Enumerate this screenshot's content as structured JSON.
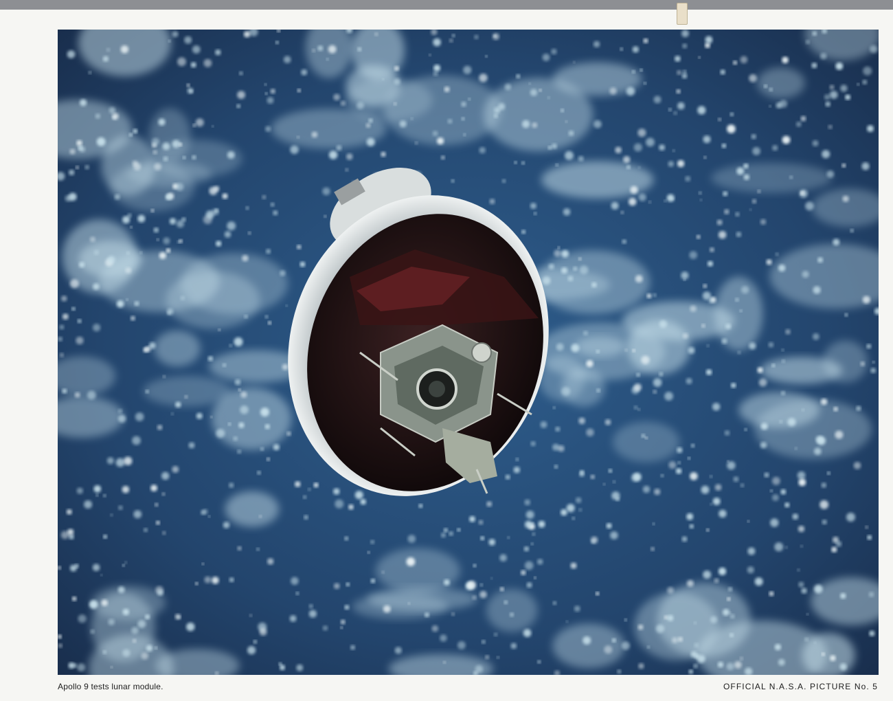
{
  "print": {
    "caption": "Apollo 9 tests lunar module.",
    "credit": "OFFICIAL N.A.S.A. PICTURE No. 5"
  },
  "photo": {
    "subject": "Saturn V S-IVB stage with lunar module over Earth clouds",
    "colors": {
      "ocean": "#23456d",
      "cloud": "#c9e2ec",
      "stage": "#d7dcdc",
      "interior": "#1a0f10",
      "module": "#9aa49a"
    }
  }
}
